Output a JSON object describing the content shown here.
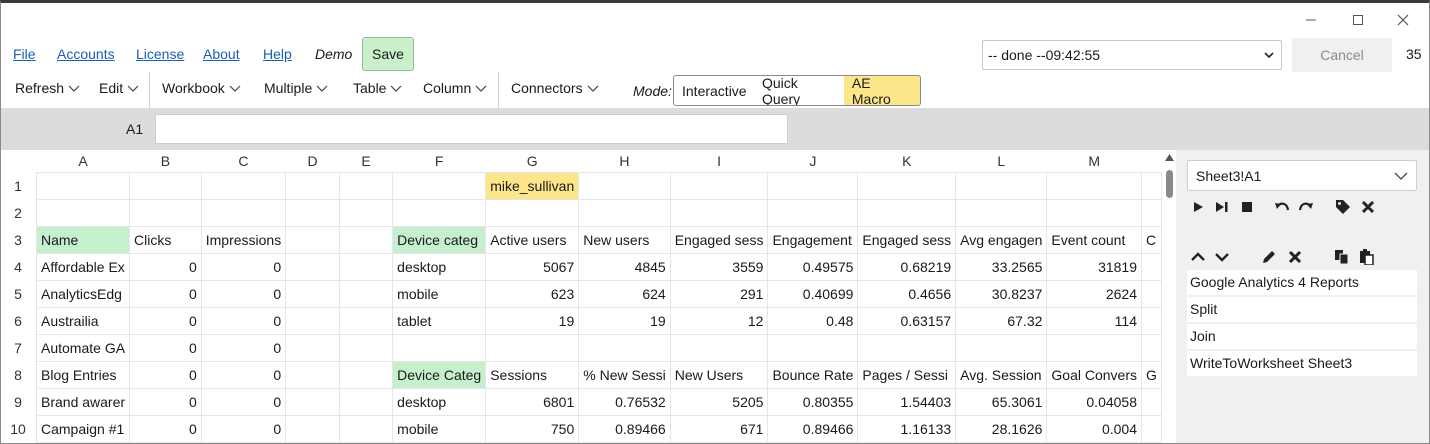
{
  "menu": {
    "file": "File",
    "accounts": "Accounts",
    "license": "License",
    "about": "About",
    "help": "Help",
    "demo": "Demo",
    "save": "Save",
    "status": "-- done --09:42:55",
    "cancel": "Cancel",
    "count": "35"
  },
  "toolbar": {
    "refresh": "Refresh",
    "edit": "Edit",
    "workbook": "Workbook",
    "multiple": "Multiple",
    "table": "Table",
    "column": "Column",
    "connectors": "Connectors",
    "mode_label": "Mode:",
    "modes": [
      "Interactive",
      "Quick Query",
      "AE Macro"
    ],
    "active_mode": "AE Macro"
  },
  "formula": {
    "cell_ref": "A1",
    "value": ""
  },
  "grid": {
    "columns": [
      "A",
      "B",
      "C",
      "D",
      "E",
      "F",
      "G",
      "H",
      "I",
      "J",
      "K",
      "L",
      "M"
    ],
    "rows": [
      {
        "n": "1",
        "cells": [
          "",
          "",
          "",
          "",
          "",
          "",
          "mike_sullivan",
          "",
          "",
          "",
          "",
          "",
          ""
        ]
      },
      {
        "n": "2",
        "cells": [
          "",
          "",
          "",
          "",
          "",
          "",
          "",
          "",
          "",
          "",
          "",
          "",
          ""
        ]
      },
      {
        "n": "3",
        "cells": [
          "Name",
          "Clicks",
          "Impressions",
          "",
          "",
          "Device categ",
          "Active users",
          "New users",
          "Engaged sess",
          "Engagement",
          "Engaged sess",
          "Avg engagen",
          "Event count"
        ]
      },
      {
        "n": "4",
        "cells": [
          "Affordable Ex",
          "0",
          "0",
          "",
          "",
          "desktop",
          "5067",
          "4845",
          "3559",
          "0.49575",
          "0.68219",
          "33.2565",
          "31819"
        ]
      },
      {
        "n": "5",
        "cells": [
          "AnalyticsEdg",
          "0",
          "0",
          "",
          "",
          "mobile",
          "623",
          "624",
          "291",
          "0.40699",
          "0.4656",
          "30.8237",
          "2624"
        ]
      },
      {
        "n": "6",
        "cells": [
          "Austrailia",
          "0",
          "0",
          "",
          "",
          "tablet",
          "19",
          "19",
          "12",
          "0.48",
          "0.63157",
          "67.32",
          "114"
        ]
      },
      {
        "n": "7",
        "cells": [
          "Automate GA",
          "0",
          "0",
          "",
          "",
          "",
          "",
          "",
          "",
          "",
          "",
          "",
          ""
        ]
      },
      {
        "n": "8",
        "cells": [
          "Blog Entries",
          "0",
          "0",
          "",
          "",
          "Device Categ",
          "Sessions",
          "% New Sessi",
          "New Users",
          "Bounce Rate",
          "Pages / Sessi",
          "Avg. Session",
          "Goal Convers"
        ]
      },
      {
        "n": "9",
        "cells": [
          "Brand awarer",
          "0",
          "0",
          "",
          "",
          "desktop",
          "6801",
          "0.76532",
          "5205",
          "0.80355",
          "1.54403",
          "65.3061",
          "0.04058"
        ]
      },
      {
        "n": "10",
        "cells": [
          "Campaign #1",
          "0",
          "0",
          "",
          "",
          "mobile",
          "750",
          "0.89466",
          "671",
          "0.89466",
          "1.16133",
          "28.1626",
          "0.004"
        ]
      }
    ],
    "extra_col": {
      "3": "C",
      "8": "G"
    }
  },
  "panel": {
    "sheet": "Sheet3!A1",
    "steps": [
      "Google Analytics 4 Reports",
      "Split",
      "Join",
      "WriteToWorksheet Sheet3"
    ]
  },
  "icons": {
    "play": "play-icon",
    "step": "step-forward-icon",
    "stop": "stop-icon",
    "undo": "undo-icon",
    "redo": "redo-icon",
    "tag": "tag-icon",
    "close": "close-icon",
    "up": "chevron-up-icon",
    "down": "chevron-down-icon",
    "edit": "pencil-icon",
    "delete": "delete-icon",
    "copy": "copy-icon",
    "paste": "paste-icon"
  },
  "colors": {
    "header_green": "#c6efce",
    "highlight_yellow": "#fde68a",
    "save_green": "#c9efcb",
    "link_blue": "#1a5fb4"
  }
}
